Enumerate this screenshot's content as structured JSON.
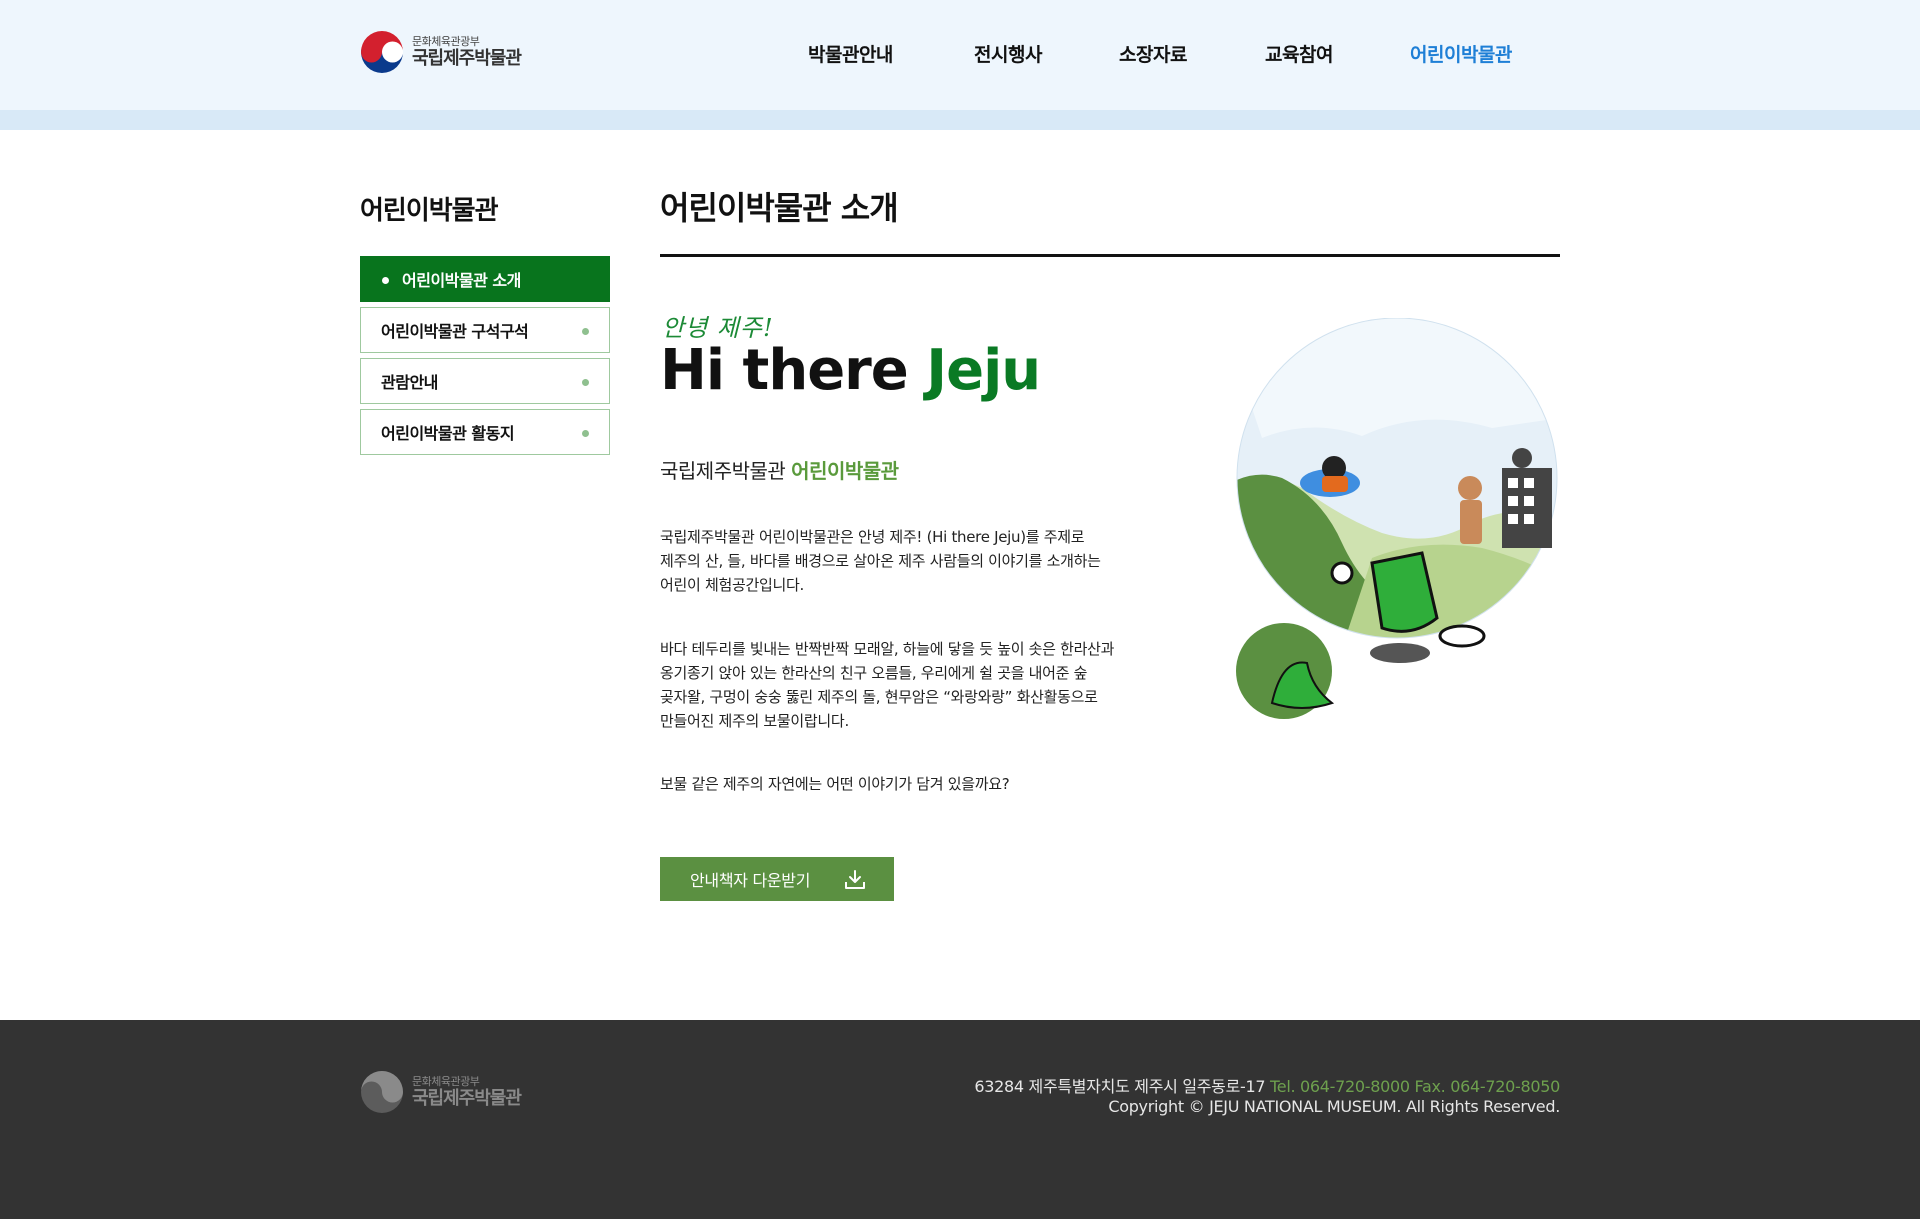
{
  "header": {
    "logo_sub": "문화체육관광부",
    "logo_main": "국립제주박물관",
    "nav": [
      {
        "label": "박물관안내",
        "active": false
      },
      {
        "label": "전시행사",
        "active": false
      },
      {
        "label": "소장자료",
        "active": false
      },
      {
        "label": "교육참여",
        "active": false
      },
      {
        "label": "어린이박물관",
        "active": true
      }
    ]
  },
  "sidebar": {
    "title": "어린이박물관",
    "items": [
      {
        "label": "어린이박물관 소개",
        "active": true
      },
      {
        "label": "어린이박물관 구석구석",
        "active": false
      },
      {
        "label": "관람안내",
        "active": false
      },
      {
        "label": "어린이박물관 활동지",
        "active": false
      }
    ]
  },
  "main": {
    "page_title": "어린이박물관 소개",
    "greeting_hand": "안녕 제주!",
    "hero_black": "Hi there ",
    "hero_green": "Jeju",
    "subhead_prefix": "국립제주박물관 ",
    "subhead_green": "어린이박물관",
    "paragraphs": [
      "국립제주박물관 어린이박물관은 안녕 제주! (Hi there Jeju)를 주제로\n제주의 산, 들, 바다를 배경으로 살아온 제주 사람들의 이야기를 소개하는\n어린이 체험공간입니다.",
      "바다 테두리를 빛내는 반짝반짝 모래알, 하늘에 닿을 듯 높이 솟은 한라산과\n옹기종기 앉아 있는 한라산의 친구 오름들, 우리에게 쉴 곳을 내어준 숲\n곶자왈, 구멍이 숭숭 뚫린 제주의 돌, 현무암은 “와랑와랑” 화산활동으로\n만들어진 제주의 보물이랍니다.",
      "보물 같은 제주의 자연에는 어떤 이야기가 담겨 있을까요?"
    ],
    "download_button": "안내책자 다운받기",
    "download_icon": "download-icon"
  },
  "footer": {
    "logo_sub": "문화체육관광부",
    "logo_main": "국립제주박물관",
    "address": "63284 제주특별자치도 제주시 일주동로-17 ",
    "tel": "Tel. 064-720-8000 Fax. 064-720-8050",
    "copyright": "Copyright © JEJU NATIONAL MUSEUM. All Rights Reserved."
  },
  "colors": {
    "brand_green": "#08741d",
    "button_green": "#5b9041",
    "nav_active_blue": "#1e7fd6",
    "header_bg": "#eef6fd",
    "footer_bg": "#333333"
  }
}
